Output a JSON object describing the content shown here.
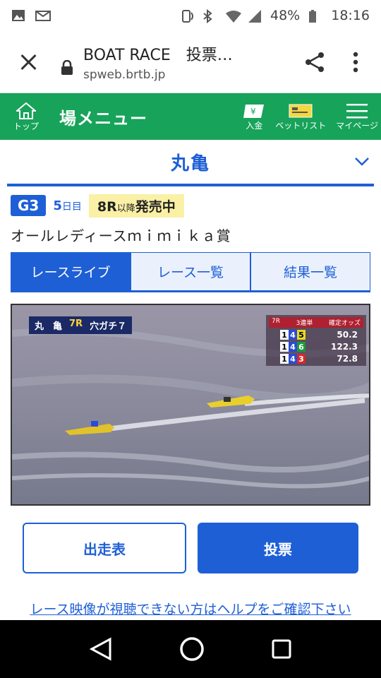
{
  "status": {
    "battery": "48%",
    "time": "18:16"
  },
  "browser": {
    "title": "BOAT RACE　投票…",
    "host": "spweb.brtb.jp"
  },
  "nav": {
    "top_label": "トップ",
    "title": "場メニュー",
    "deposit_label": "入金",
    "betlist_label": "ベットリスト",
    "mypage_label": "マイページ"
  },
  "venue": {
    "name": "丸亀"
  },
  "race_info": {
    "grade": "G3",
    "day_num": "5",
    "day_unit": "日目",
    "sale_race": "8R",
    "sale_after": "以降",
    "sale_status": "発売中",
    "race_name": "オールレディースｍｉｍｉｋａ賞"
  },
  "tabs": [
    {
      "label": "レースライブ",
      "active": true
    },
    {
      "label": "レース一覧",
      "active": false
    },
    {
      "label": "結果一覧",
      "active": false
    }
  ],
  "video_overlay": {
    "venue": "丸　亀",
    "race": "7R",
    "caption": "穴ガチ７",
    "odds_head_left": "7R",
    "odds_head_mid": "3連単",
    "odds_head_right": "確定オッズ",
    "odds": [
      {
        "c1": "1",
        "c2": "4",
        "c3": "5",
        "value": "50.2"
      },
      {
        "c1": "1",
        "c2": "4",
        "c3": "6",
        "value": "122.3"
      },
      {
        "c1": "1",
        "c2": "4",
        "c3": "3",
        "value": "72.8"
      }
    ]
  },
  "buttons": {
    "entry": "出走表",
    "vote": "投票"
  },
  "help_link": "レース映像が視聴できない方はヘルプをご確認下さい",
  "colors": {
    "green": "#17a35a",
    "blue": "#1e5fd6",
    "sale_bg": "#faf0a6"
  }
}
